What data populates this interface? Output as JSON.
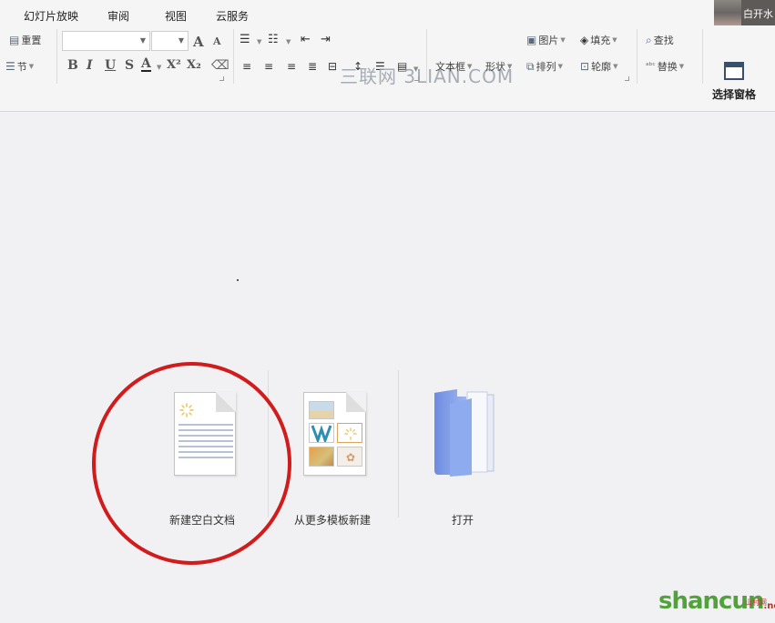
{
  "menubar": {
    "items": [
      "幻灯片放映",
      "审阅",
      "视图",
      "云服务"
    ],
    "profile_text": "白开水"
  },
  "ribbon": {
    "reset_label": "重置",
    "section_label": "节",
    "font_name": "",
    "font_size": "",
    "increase_font": "A",
    "decrease_font": "A",
    "bold": "B",
    "italic": "I",
    "underline": "U",
    "strike": "S",
    "font_color": "A",
    "superscript": "X²",
    "subscript": "X₂",
    "picture_label": "图片",
    "fill_label": "填充",
    "find_label": "查找",
    "textbox_label": "文本框",
    "shape_label": "形状",
    "arrange_label": "排列",
    "outline_label": "轮廓",
    "replace_label": "替换",
    "select_pane_label": "选择窗格",
    "watermark_text": "三联网 3LIAN.COM"
  },
  "main": {
    "new_blank_label": "新建空白文档",
    "from_template_label": "从更多模板新建",
    "open_label": "打开"
  },
  "brand": {
    "logo_text": "shancun",
    "logo_net": ".net",
    "logo_cn": "山村网",
    "accent_green": "#52a13c",
    "circle_red": "#d01c1c"
  }
}
